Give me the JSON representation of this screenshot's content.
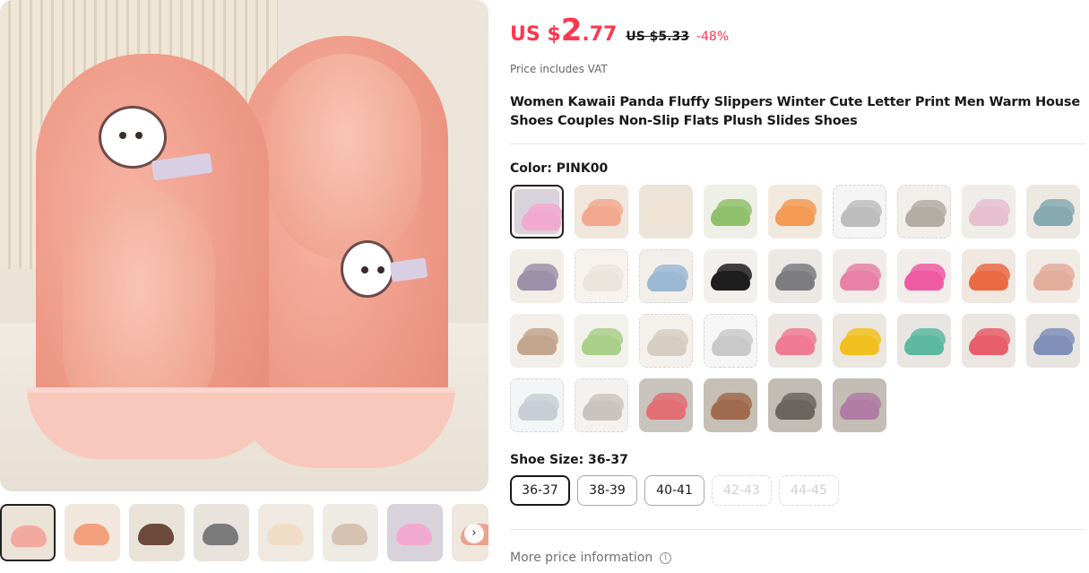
{
  "price": {
    "currency": "US $",
    "integer": "2",
    "decimal": ".77",
    "original": "US $5.33",
    "discount": "-48%",
    "vat_note": "Price includes VAT"
  },
  "product": {
    "title": "Women Kawaii Panda Fluffy Slippers Winter Cute Letter Print Men Warm House Shoes Couples Non-Slip Flats Plush Slides Shoes"
  },
  "color": {
    "label": "Color: PINK00",
    "swatches": [
      {
        "main": "#f2a9cf",
        "bg": "#d8d2dc"
      },
      {
        "main": "#f2a88f",
        "bg": "#f0e6dc"
      },
      {
        "main": "#f1e3d3",
        "bg": "#ece4d8"
      },
      {
        "main": "#8fc06c",
        "bg": "#eef0e8"
      },
      {
        "main": "#f39a55",
        "bg": "#f2e9de"
      },
      {
        "main": "#bdbdbd",
        "bg": "#f5f5f5"
      },
      {
        "main": "#b3aca5",
        "bg": "#f2efeb"
      },
      {
        "main": "#e6c0cf",
        "bg": "#f0ece8"
      },
      {
        "main": "#86a9b2",
        "bg": "#ede9e2"
      },
      {
        "main": "#9c8fa8",
        "bg": "#f1ede7"
      },
      {
        "main": "#eae4dd",
        "bg": "#f6f3ef"
      },
      {
        "main": "#9cb8d3",
        "bg": "#f2eee9"
      },
      {
        "main": "#1e1e1e",
        "bg": "#f2f0ed"
      },
      {
        "main": "#7d7d80",
        "bg": "#ece9e5"
      },
      {
        "main": "#e782a6",
        "bg": "#f1ebe9"
      },
      {
        "main": "#ee5aa3",
        "bg": "#f2ecea"
      },
      {
        "main": "#e96a43",
        "bg": "#efe7e0"
      },
      {
        "main": "#e3ad9c",
        "bg": "#f1ebe5"
      },
      {
        "main": "#c2a58d",
        "bg": "#f2eee9"
      },
      {
        "main": "#a9cf8a",
        "bg": "#f2f1ec"
      },
      {
        "main": "#d6ccc1",
        "bg": "#f4f1ed"
      },
      {
        "main": "#c9c9c9",
        "bg": "#f6f6f6"
      },
      {
        "main": "#f07a92",
        "bg": "#ebe6e2"
      },
      {
        "main": "#f1c01e",
        "bg": "#ebe6e0"
      },
      {
        "main": "#5cb8a0",
        "bg": "#e9e6e1"
      },
      {
        "main": "#e85e6a",
        "bg": "#ebe6e1"
      },
      {
        "main": "#7f8fb8",
        "bg": "#e8e5e0"
      },
      {
        "main": "#c9ced6",
        "bg": "#f4f5f7"
      },
      {
        "main": "#c9c4c0",
        "bg": "#f4f2f0"
      },
      {
        "main": "#e26f73",
        "bg": "#c9c4bd"
      },
      {
        "main": "#a06a4e",
        "bg": "#c6bfb6"
      },
      {
        "main": "#6b6560",
        "bg": "#c2bcb4"
      },
      {
        "main": "#b07ba4",
        "bg": "#c4bdb6"
      }
    ]
  },
  "size": {
    "label": "Shoe Size: 36-37",
    "options": [
      {
        "label": "36-37",
        "state": "selected"
      },
      {
        "label": "38-39",
        "state": "available"
      },
      {
        "label": "40-41",
        "state": "available"
      },
      {
        "label": "42-43",
        "state": "disabled"
      },
      {
        "label": "44-45",
        "state": "disabled"
      }
    ]
  },
  "more_info": "More price information",
  "info_icon": "ⓘ",
  "gallery": {
    "next_arrow": "›",
    "thumbs": [
      {
        "main": "#f2a9a0",
        "bg": "#ece3d8"
      },
      {
        "main": "#f2a07e",
        "bg": "#f1e7dd"
      },
      {
        "main": "#6b4a3a",
        "bg": "#e9e2d8"
      },
      {
        "main": "#7a7a7a",
        "bg": "#e8e3dc"
      },
      {
        "main": "#f1dcc6",
        "bg": "#efe9e1"
      },
      {
        "main": "#d6c2b0",
        "bg": "#eeeae4"
      },
      {
        "main": "#f2a9cf",
        "bg": "#d8d2dc"
      },
      {
        "main": "#e9a48f",
        "bg": "#efe6dc"
      }
    ]
  }
}
